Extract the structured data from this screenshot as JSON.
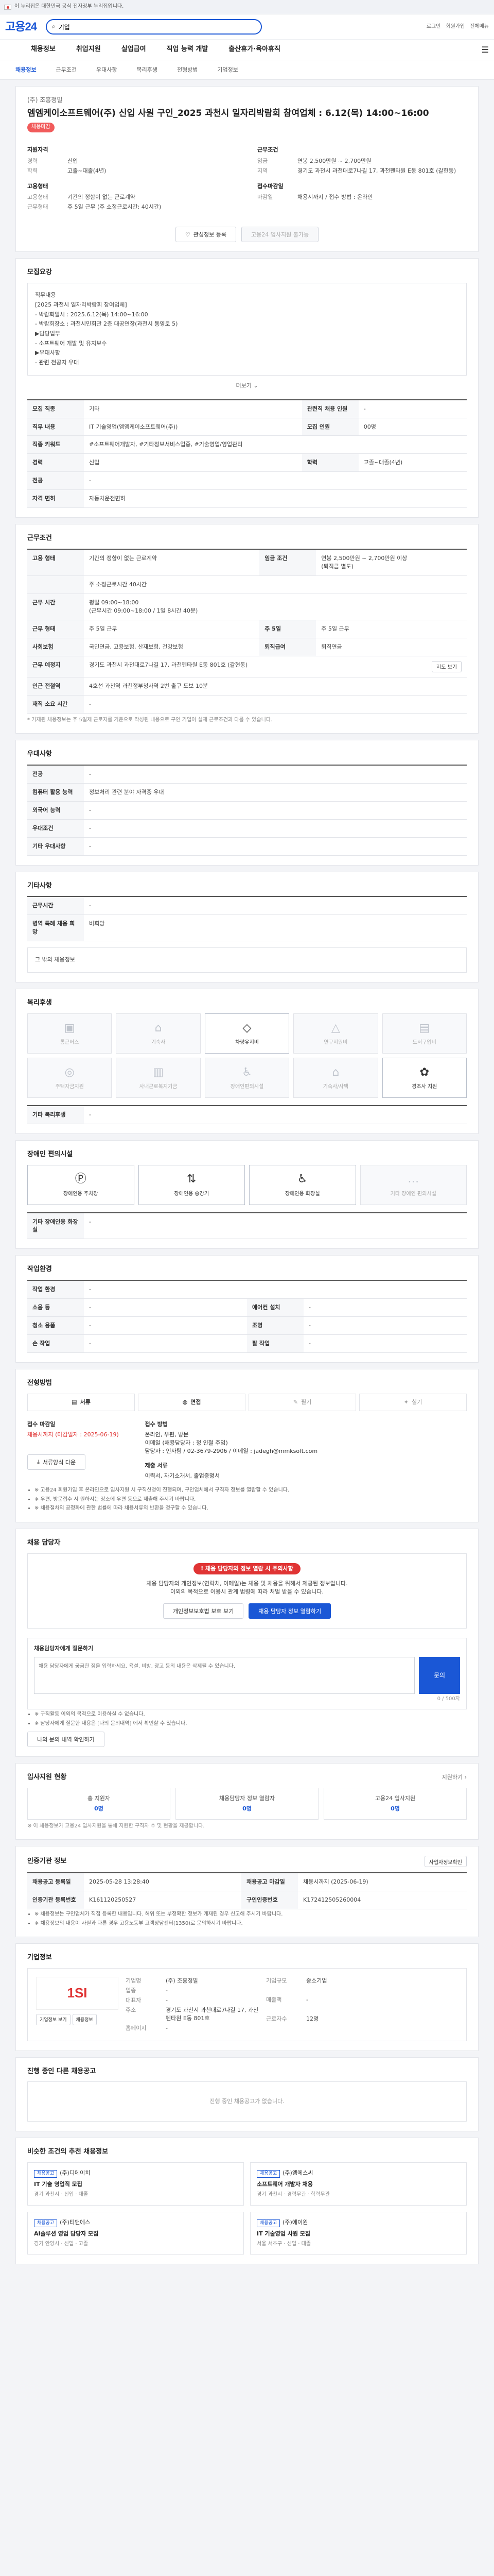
{
  "gov_bar": {
    "text": "이 누리집은 대한민국 공식 전자정부 누리집입니다."
  },
  "header": {
    "logo": "고용24",
    "search_value": "기업",
    "util": [
      "로그인",
      "회원가입",
      "전체메뉴"
    ],
    "gnb": [
      "채용정보",
      "취업지원",
      "실업급여",
      "직업 능력 개발",
      "출산휴가·육아휴직"
    ]
  },
  "tabs": [
    {
      "label": "채용정보",
      "on": true
    },
    {
      "label": "근무조건",
      "on": false
    },
    {
      "label": "우대사항",
      "on": false
    },
    {
      "label": "복리후생",
      "on": false
    },
    {
      "label": "전형방법",
      "on": false
    },
    {
      "label": "기업정보",
      "on": false
    }
  ],
  "job": {
    "company": "(주) 조흥정밀",
    "title": "엠엠케이소프트웨어(주) 신입 사원 구인_2025 과천시 일자리박람회 참여업체 : 6.12(목) 14:00~16:00",
    "badge": "채용마감",
    "applicant_title": "지원자격",
    "applicant": [
      [
        "경력",
        "신입"
      ],
      [
        "학력",
        "고졸~대졸(4년)"
      ]
    ],
    "condition_title": "근무조건",
    "condition": [
      [
        "임금",
        "연봉 2,500만원 ~ 2,700만원"
      ],
      [
        "지역",
        "경기도 과천시 과천대로7나길 17, 과천펜타원 E동 801호 (갈현동)"
      ]
    ],
    "form_title": "고용형태",
    "form": [
      [
        "고용형태",
        "기간의 정함이 없는 근로계약"
      ],
      [
        "근무형태",
        "주 5일 근무 (주 소정근로시간: 40시간)"
      ]
    ],
    "period_title": "접수마감일",
    "period": [
      [
        "마감일",
        "채용시까지 / 접수 방법 : 온라인"
      ]
    ],
    "btn_scrap": "관심정보 등록",
    "btn_apply": "고용24 입사지원 불가능"
  },
  "recruit": {
    "title": "모집요강",
    "body_lines": [
      "직무내용",
      "[2025 과천시 일자리박람회 참여업체]",
      "  - 박람회일시 : 2025.6.12(목) 14:00~16:00",
      "  - 박람회장소 : 과천시민회관 2층 대공연장(과천시 통영로 5)",
      "▶담당업무",
      "  - 소프트웨어 개발 및 유지보수",
      "▶우대사항",
      "  - 관련 전공자 우대"
    ],
    "more": "더보기",
    "rows": [
      [
        [
          "모집 직종",
          "기타"
        ],
        [
          "관련직 채용 인원",
          "-"
        ]
      ],
      [
        [
          "직무 내용",
          "IT 기술영업(엠엠케이소프트웨어(주))"
        ],
        [
          "모집 인원",
          "00명"
        ]
      ],
      [
        [
          "직종 키워드",
          "#소프트웨어개발자, #기타정보서비스업종, #기술영업/영업관리"
        ],
        [
          "",
          ""
        ]
      ],
      [
        [
          "경력",
          "신입"
        ],
        [
          "학력",
          "고졸~대졸(4년)"
        ]
      ],
      [
        [
          "전공",
          "-"
        ],
        [
          "",
          ""
        ]
      ],
      [
        [
          "자격 면허",
          "자동차운전면허"
        ],
        [
          "",
          ""
        ]
      ]
    ]
  },
  "work": {
    "title": "근무조건",
    "rows": [
      [
        [
          "고용 형태",
          "기간의 정함이 없는 근로계약"
        ],
        [
          "임금 조건",
          "연봉 2,500만원 ~ 2,700만원 이상\n(퇴직금 별도)"
        ]
      ],
      [
        [
          "",
          "주 소정근로시간 40시간"
        ],
        [
          "",
          ""
        ]
      ],
      [
        [
          "근무 시간",
          "평일 09:00~18:00\n(근무시간 09:00~18:00 / 1일 8시간 40분)"
        ],
        [
          "",
          ""
        ]
      ],
      [
        [
          "근무 형태",
          "주 5일 근무"
        ],
        [
          "주 5일",
          "주 5일 근무"
        ]
      ],
      [
        [
          "사회보험",
          "국민연금, 고용보험, 산재보험, 건강보험"
        ],
        [
          "퇴직급여",
          "퇴직연금"
        ]
      ],
      [
        [
          "근무 예정지",
          "경기도 과천시 과천대로7나길 17, 과천펜타원 E동 801호 (갈현동)"
        ],
        [
          "",
          "지도 보기"
        ]
      ],
      [
        [
          "인근 전철역",
          "4호선 과천역 과천정부청사역 2번 출구 도보 10분"
        ],
        [
          "",
          ""
        ]
      ],
      [
        [
          "재직 소요 시간",
          "-"
        ],
        [
          "",
          ""
        ]
      ]
    ],
    "note": "* 기재된 채용정보는 주 5일제 근로자를 기준으로 작성된 내용으로 구인 기업이 실제 근로조건과 다를 수 있습니다."
  },
  "prefer": {
    "title": "우대사항",
    "rows": [
      [
        "전공",
        "-"
      ],
      [
        "컴퓨터 활용 능력",
        "정보처리 관련 분야 자격증 우대"
      ],
      [
        "외국어 능력",
        "-"
      ],
      [
        "우대조건",
        "-"
      ],
      [
        "기타 우대사항",
        "-"
      ]
    ]
  },
  "other": {
    "title": "기타사항",
    "rows": [
      [
        "근무시간",
        "-"
      ],
      [
        "병역 특례 채용 희망",
        "비희망"
      ]
    ],
    "caption": "그 밖의 채용정보"
  },
  "benefit": {
    "title": "복리후생",
    "items": [
      {
        "label": "통근버스",
        "on": false
      },
      {
        "label": "기숙사",
        "on": false
      },
      {
        "label": "차량유지비",
        "on": true
      },
      {
        "label": "연구지원비",
        "on": false
      },
      {
        "label": "도서구입비",
        "on": false
      },
      {
        "label": "주택자금지원",
        "on": false
      },
      {
        "label": "사내근로복지기금",
        "on": false
      },
      {
        "label": "장애인편의시설",
        "on": false
      },
      {
        "label": "기숙사/사택",
        "on": false
      },
      {
        "label": "경조사 지원",
        "on": true
      }
    ],
    "other_label": "기타 복리후생",
    "other_value": "-"
  },
  "disabled": {
    "title": "장애인 편의시설",
    "items": [
      {
        "label": "장애인용 주차장",
        "on": true
      },
      {
        "label": "장애인용 승강기",
        "on": true
      },
      {
        "label": "장애인용 화장실",
        "on": true
      },
      {
        "label": "기타 장애인 편의시설",
        "on": false
      }
    ],
    "other_label": "기타 장애인용 화장실",
    "other_value": "-"
  },
  "workenv": {
    "title": "작업환경",
    "rows": [
      [
        [
          "작업 환경",
          "-"
        ],
        [
          "",
          ""
        ]
      ],
      [
        [
          "소음 등",
          "-"
        ],
        [
          "에어컨 설치",
          "-"
        ]
      ],
      [
        [
          "청소 용품",
          "-"
        ],
        [
          "조명",
          "-"
        ]
      ],
      [
        [
          "손 작업",
          "-"
        ],
        [
          "팔 작업",
          "-"
        ]
      ]
    ]
  },
  "selection": {
    "title": "전형방법",
    "steps": [
      {
        "label": "서류",
        "on": true
      },
      {
        "label": "면접",
        "on": true
      },
      {
        "label": "필기",
        "on": false
      },
      {
        "label": "실기",
        "on": false
      }
    ],
    "period_title": "접수 마감일",
    "period_value": "채용시까지 (마감일자 : 2025-06-19)",
    "method_title": "접수 방법",
    "method_value": "온라인, 우편, 방문\n이메일 (채용담당자 : 정 인철 주임)",
    "method_detail": "담당자 : 인사팀 / 02-3679-2906 / 이메일 : jadegh@mmksoft.com",
    "docs_title": "제출 서류",
    "docs_value": "이력서, 자기소개서, 졸업증명서",
    "btn": "서류양식 다운",
    "notes": [
      "※ 고용24 회원가입 후 온라인으로 입사지원 시 구직신청이 진행되며, 구인업체에서 구직자 정보를 열람할 수 있습니다.",
      "※ 우편, 방문접수 시 원하시는 장소에 우편 등으로 제출해 주시기 바랍니다.",
      "※ 채용절차의 공정화에 관한 법률에 따라 채용서류의 반환을 청구할 수 있습니다."
    ]
  },
  "contact": {
    "title": "채용 담당자",
    "alert_title": "채용 담당자와 정보 열람 시 주의사항",
    "alert_lines": [
      "채용 담당자의 개인정보(연락처, 이메일)는 채용 및 채용을 위해서 제공된 정보입니다.",
      "이외의 목적으로 이용시 관계 법령에 따라 처벌 받을 수 있습니다."
    ],
    "btn_check": "개인정보보호법 보호 보기",
    "btn_view": "채용 담당자 정보 열람하기",
    "inquiry_title": "채용담당자에게 질문하기",
    "inquiry_placeholder": "채용 담당자에게 궁금한 점을 입력하세요. 욕설, 비방, 광고 등의 내용은 삭제될 수 있습니다.",
    "inquiry_count": "0 / 500자",
    "inquiry_btn": "문의",
    "inquiry_notes": [
      "※ 구직활동 이외의 목적으로 이용하실 수 없습니다.",
      "※ 담당자에게 질문한 내용은 [나의 문의내역] 에서 확인할 수 있습니다."
    ],
    "inquiry_link": "나의 문의 내역 확인하기"
  },
  "support": {
    "title": "입사지원 현황",
    "more": "지원하기",
    "items": [
      {
        "label": "총 지원자",
        "value": "0명"
      },
      {
        "label": "채용담당자 정보 열람자",
        "value": "0명"
      },
      {
        "label": "고용24 입사지원",
        "value": "0명"
      }
    ],
    "note": "※ 이 채용정보가 고용24 입사지원을 통해 지원한 구직자 수 및 현황을 제공합니다."
  },
  "recruit_info": {
    "title": "인증기관 정보",
    "btn": "사업자정보확인",
    "rows": [
      [
        [
          "채용공고 등록일",
          "2025-05-28 13:28:40"
        ],
        [
          "채용공고 마감일",
          "채용시까지 (2025-06-19)"
        ]
      ],
      [
        [
          "인증기관 등록번호",
          "K161120250527"
        ],
        [
          "구인인증번호",
          "K172412505260004"
        ]
      ]
    ],
    "notes": [
      "※ 채용정보는 구인업체가 직접 등록한 내용입니다. 허위 또는 부정확한 정보가 게재된 경우 신고해 주시기 바랍니다.",
      "※ 채용정보의 내용이 사실과 다른 경우 고용노동부 고객상담센터(1350)로 문의하시기 바랍니다."
    ]
  },
  "company": {
    "title": "기업정보",
    "logo_text": "1SI",
    "name_label": "기업명",
    "name": "(주) 조흥정밀",
    "industry_label": "업종",
    "industry": "-",
    "ceo_label": "대표자",
    "ceo": "-",
    "size_label": "기업규모",
    "size": "중소기업",
    "revenue_label": "매출액",
    "revenue": "-",
    "employee_label": "근로자수",
    "employee": "12명",
    "address_label": "주소",
    "address": "경기도 과천시 과천대로7나길 17, 과천펜타원 E동 801호",
    "homepage_label": "홈페이지",
    "homepage": "-",
    "btn_info": "기업정보 보기",
    "btn_jobs": "채용정보"
  },
  "similar": {
    "title": "진행 중인 다른 채용공고",
    "empty": "진행 중인 채용공고가 없습니다."
  },
  "reco": {
    "title": "비슷한 조건의 추천 채용정보",
    "cards": [
      {
        "tag": "채용공고",
        "company": "(주)디에이치",
        "ttl": "IT 기술 영업직 모집",
        "meta": "경기 과천시 · 신입 · 대졸"
      },
      {
        "tag": "채용공고",
        "company": "(주)엠에스씨",
        "ttl": "소프트웨어 개발자 채용",
        "meta": "경기 과천시 · 경력무관 · 학력무관"
      },
      {
        "tag": "채용공고",
        "company": "(주)티앤에스",
        "ttl": "AI솔루션 영업 담당자 모집",
        "meta": "경기 안양시 · 신입 · 고졸"
      },
      {
        "tag": "채용공고",
        "company": "(주)에이원",
        "ttl": "IT 기술영업 사원 모집",
        "meta": "서울 서초구 · 신입 · 대졸"
      }
    ]
  }
}
